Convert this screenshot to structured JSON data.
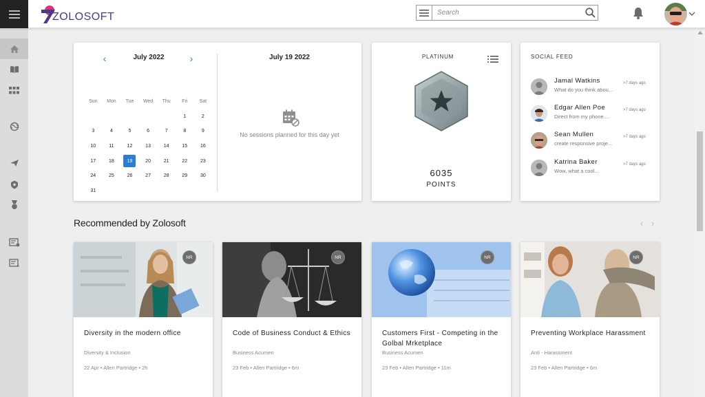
{
  "header": {
    "logo_text": "ZOLOSOFT",
    "search_placeholder": "Search"
  },
  "calendar": {
    "month_label": "July 2022",
    "weekdays": [
      "Sun",
      "Mon",
      "Tue",
      "Wed",
      "Thu",
      "Fri",
      "Sat"
    ],
    "weeks": [
      [
        "",
        "",
        "",
        "",
        "",
        "1",
        "2"
      ],
      [
        "3",
        "4",
        "5",
        "6",
        "7",
        "8",
        "9"
      ],
      [
        "10",
        "11",
        "12",
        "13",
        "14",
        "15",
        "16"
      ],
      [
        "17",
        "18",
        "19",
        "20",
        "21",
        "22",
        "23"
      ],
      [
        "24",
        "25",
        "26",
        "27",
        "28",
        "29",
        "30"
      ],
      [
        "31",
        "",
        "",
        "",
        "",
        "",
        ""
      ]
    ],
    "selected_day": "19",
    "selected_date_label": "July 19 2022",
    "empty_message": "No sessions planned for this day yet"
  },
  "points": {
    "tier": "PLATINUM",
    "value": "6035",
    "label": "POINTS"
  },
  "social_feed": {
    "title": "SOCIAL FEED",
    "items": [
      {
        "name": "Jamal Watkins",
        "message": "What do you think abou...",
        "time": ">7 days ago"
      },
      {
        "name": "Edgar Allen Poe",
        "message": "Direct from my phone....",
        "time": ">7 days ago"
      },
      {
        "name": "Sean Mullen",
        "message": "create responsive proje...",
        "time": ">7 days ago"
      },
      {
        "name": "Katrina Baker",
        "message": "Wow, what a cool...",
        "time": ">7 days ago"
      }
    ]
  },
  "recommended": {
    "title": "Recommended by Zolosoft",
    "courses": [
      {
        "badge": "NR",
        "title": "Diversity in the modern office",
        "category": "Diversity & Inclusion",
        "meta": "22 Apr • Allen Partridge • 2h"
      },
      {
        "badge": "NR",
        "title": "Code of Business Conduct & Ethics",
        "category": "Business Acumen",
        "meta": "23 Feb • Allen Partridge • 6m"
      },
      {
        "badge": "NR",
        "title": "Customers First - Competing in the Golbal Mrketplace",
        "category": "Business Acumen",
        "meta": "23 Feb • Allen Partridge • 11m"
      },
      {
        "badge": "NR",
        "title": "Preventing Workplace Harassment",
        "category": "Anti - Harassment",
        "meta": "23 Feb • Allen Partridge • 6m"
      }
    ]
  },
  "colors": {
    "accent": "#2c7dd3",
    "logo": "#4a3b86",
    "sidebar": "#dcdcdc"
  }
}
